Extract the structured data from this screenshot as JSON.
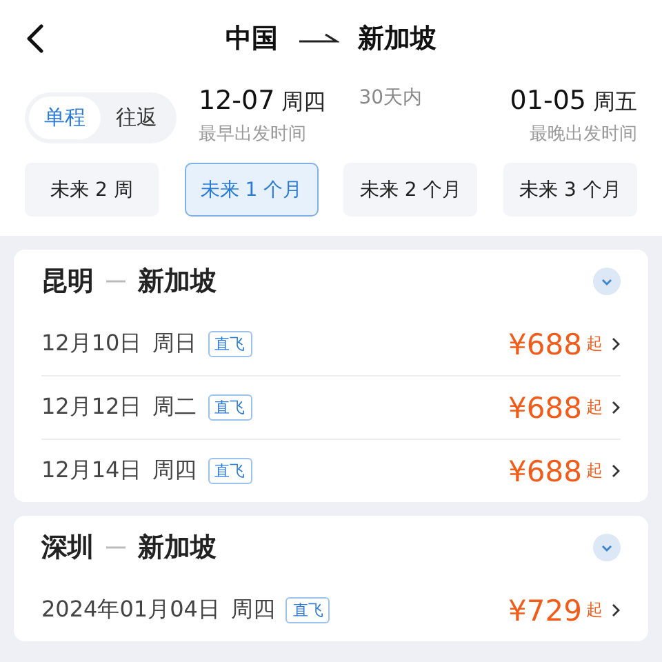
{
  "header": {
    "origin": "中国",
    "destination": "新加坡"
  },
  "trip_types": [
    {
      "label": "单程",
      "selected": true
    },
    {
      "label": "往返",
      "selected": false
    }
  ],
  "date_range": {
    "start_date": "12-07",
    "start_weekday": "周四",
    "start_caption": "最早出发时间",
    "span": "30天内",
    "end_date": "01-05",
    "end_weekday": "周五",
    "end_caption": "最晚出发时间"
  },
  "ranges": [
    {
      "label": "未来 2 周",
      "selected": false
    },
    {
      "label": "未来 1 个月",
      "selected": true
    },
    {
      "label": "未来 2 个月",
      "selected": false
    },
    {
      "label": "未来 3 个月",
      "selected": false
    }
  ],
  "routes": [
    {
      "origin": "昆明",
      "destination": "新加坡",
      "flights": [
        {
          "date": "12月10日",
          "weekday": "周日",
          "tag": "直飞",
          "price": "¥688",
          "suffix": "起"
        },
        {
          "date": "12月12日",
          "weekday": "周二",
          "tag": "直飞",
          "price": "¥688",
          "suffix": "起"
        },
        {
          "date": "12月14日",
          "weekday": "周四",
          "tag": "直飞",
          "price": "¥688",
          "suffix": "起"
        }
      ]
    },
    {
      "origin": "深圳",
      "destination": "新加坡",
      "flights": [
        {
          "date": "2024年01月04日",
          "weekday": "周四",
          "tag": "直飞",
          "price": "¥729",
          "suffix": "起"
        }
      ]
    }
  ]
}
